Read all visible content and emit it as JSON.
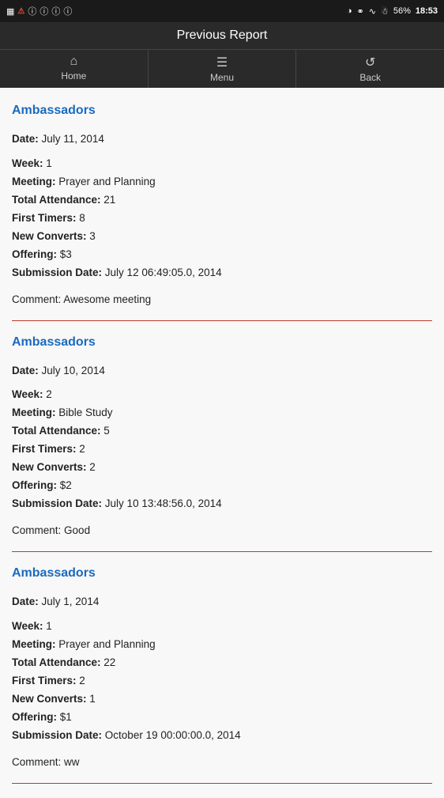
{
  "statusBar": {
    "leftIcons": [
      "bbm",
      "sos",
      "i1",
      "i2",
      "i3",
      "i4"
    ],
    "rightIcons": [
      "eye",
      "bluetooth",
      "wifi",
      "signal",
      "battery"
    ],
    "battery": "56%",
    "time": "18:53"
  },
  "titleBar": {
    "title": "Previous Report"
  },
  "navBar": {
    "items": [
      {
        "icon": "home",
        "label": "Home"
      },
      {
        "icon": "menu",
        "label": "Menu"
      },
      {
        "icon": "back",
        "label": "Back"
      }
    ]
  },
  "reports": [
    {
      "group": "Ambassadors",
      "date": "July 11, 2014",
      "week": "1",
      "meeting": "Prayer and Planning",
      "totalAttendance": "21",
      "firstTimers": "8",
      "newConverts": "3",
      "offering": "$3",
      "submissionDate": "July 12 06:49:05.0, 2014",
      "comment": "Awesome meeting"
    },
    {
      "group": "Ambassadors",
      "date": "July 10, 2014",
      "week": "2",
      "meeting": "Bible Study",
      "totalAttendance": "5",
      "firstTimers": "2",
      "newConverts": "2",
      "offering": "$2",
      "submissionDate": "July 10 13:48:56.0, 2014",
      "comment": "Good"
    },
    {
      "group": "Ambassadors",
      "date": "July 1, 2014",
      "week": "1",
      "meeting": "Prayer and Planning",
      "totalAttendance": "22",
      "firstTimers": "2",
      "newConverts": "1",
      "offering": "$1",
      "submissionDate": "October 19 00:00:00.0, 2014",
      "comment": "ww"
    }
  ],
  "labels": {
    "date": "Date:",
    "week": "Week:",
    "meeting": "Meeting:",
    "totalAttendance": "Total Attendance:",
    "firstTimers": "First Timers:",
    "newConverts": "New Converts:",
    "offering": "Offering:",
    "submissionDate": "Submission Date:",
    "comment": "Comment:"
  }
}
